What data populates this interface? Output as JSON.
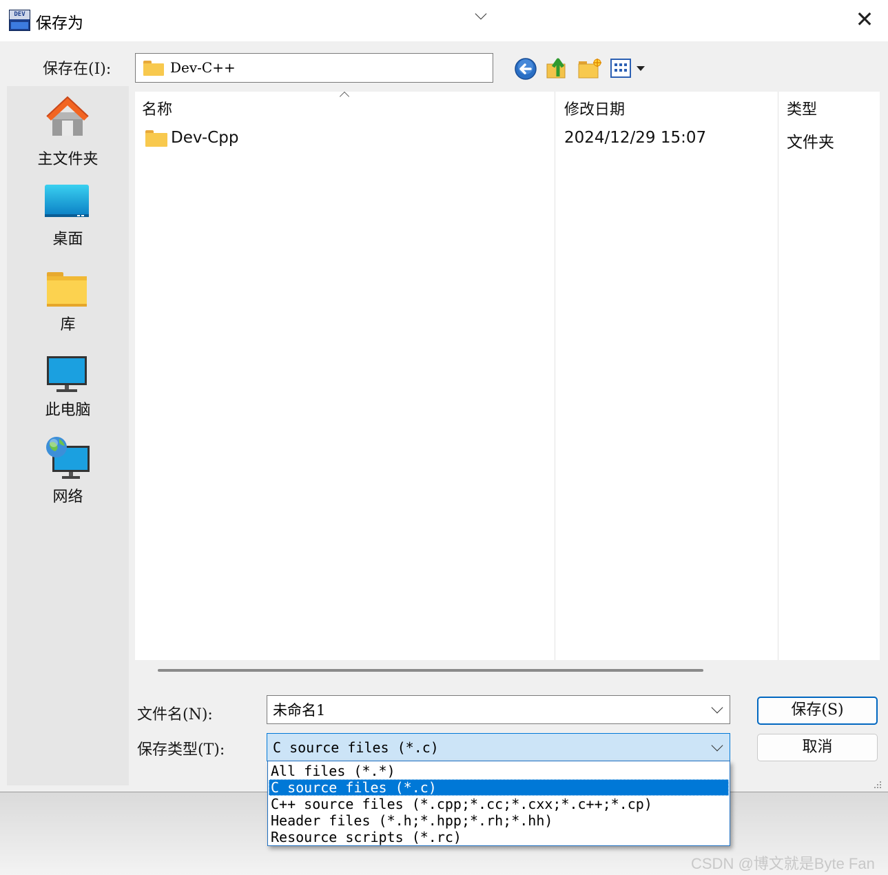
{
  "window": {
    "title": "保存为",
    "close_glyph": "✕",
    "app_icon_text": "DEV"
  },
  "save_in": {
    "label": "保存在(I):",
    "value": "Dev-C++"
  },
  "toolbar": {
    "back_icon": "back-arrow-icon",
    "up_icon": "up-folder-icon",
    "new_folder_icon": "new-folder-icon",
    "view_icon": "view-menu-icon"
  },
  "places": [
    {
      "label": "主文件夹",
      "icon": "home-icon"
    },
    {
      "label": "桌面",
      "icon": "desktop-icon"
    },
    {
      "label": "库",
      "icon": "library-icon"
    },
    {
      "label": "此电脑",
      "icon": "computer-icon"
    },
    {
      "label": "网络",
      "icon": "network-icon"
    }
  ],
  "filelist": {
    "columns": {
      "name": "名称",
      "modified": "修改日期",
      "type": "类型"
    },
    "rows": [
      {
        "name": "Dev-Cpp",
        "modified": "2024/12/29 15:07",
        "type": "文件夹"
      }
    ]
  },
  "filename": {
    "label": "文件名(N):",
    "value": "未命名1"
  },
  "filetype": {
    "label": "保存类型(T):",
    "value": "C source files (*.c)",
    "options": [
      "All files (*.*)",
      "C source files (*.c)",
      "C++ source files (*.cpp;*.cc;*.cxx;*.c++;*.cp)",
      "Header files (*.h;*.hpp;*.rh;*.hh)",
      "Resource scripts (*.rc)"
    ],
    "selected_index": 1
  },
  "buttons": {
    "save": "保存(S)",
    "cancel": "取消"
  },
  "colors": {
    "accent": "#0078d7",
    "selected_field": "#cce4f7",
    "folder": "#f8c94e"
  },
  "watermark": "CSDN @博文就是Byte Fan"
}
